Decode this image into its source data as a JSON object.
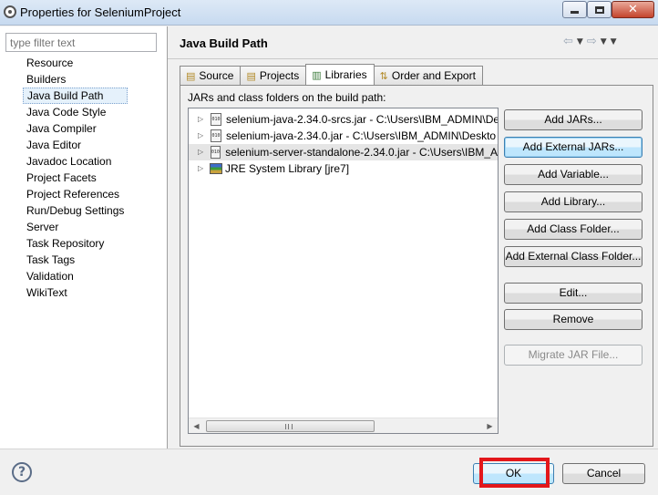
{
  "window": {
    "title": "Properties for SeleniumProject",
    "controls": {
      "minimize": "minimize-icon",
      "maximize": "maximize-icon",
      "close": "close-icon"
    }
  },
  "filter": {
    "placeholder": "type filter text",
    "value": ""
  },
  "nav": {
    "items": [
      "Resource",
      "Builders",
      "Java Build Path",
      "Java Code Style",
      "Java Compiler",
      "Java Editor",
      "Javadoc Location",
      "Project Facets",
      "Project References",
      "Run/Debug Settings",
      "Server",
      "Task Repository",
      "Task Tags",
      "Validation",
      "WikiText"
    ],
    "selected": "Java Build Path"
  },
  "page": {
    "title": "Java Build Path",
    "nav_icons": [
      "back-arrow-icon",
      "dropdown-icon",
      "forward-arrow-icon",
      "dropdown-icon",
      "view-menu-icon"
    ]
  },
  "tabs": [
    {
      "label": "Source",
      "icon": "source-folder-icon"
    },
    {
      "label": "Projects",
      "icon": "projects-icon"
    },
    {
      "label": "Libraries",
      "icon": "libraries-icon",
      "active": true
    },
    {
      "label": "Order and Export",
      "icon": "order-export-icon"
    }
  ],
  "libraries": {
    "label": "JARs and class folders on the build path:",
    "entries": [
      {
        "text": "selenium-java-2.34.0-srcs.jar - C:\\Users\\IBM_ADMIN\\De",
        "icon": "jar-icon"
      },
      {
        "text": "selenium-java-2.34.0.jar - C:\\Users\\IBM_ADMIN\\Deskto",
        "icon": "jar-icon"
      },
      {
        "text": "selenium-server-standalone-2.34.0.jar - C:\\Users\\IBM_A",
        "icon": "jar-icon",
        "selected": true
      },
      {
        "text": "JRE System Library [jre7]",
        "icon": "library-icon"
      }
    ],
    "buttons": {
      "add_jars": "Add JARs...",
      "add_external_jars": "Add External JARs...",
      "add_variable": "Add Variable...",
      "add_library": "Add Library...",
      "add_class_folder": "Add Class Folder...",
      "add_external_class_folder": "Add External Class Folder...",
      "edit": "Edit...",
      "remove": "Remove",
      "migrate_jar": "Migrate JAR File..."
    }
  },
  "footer": {
    "help_icon": "help-icon",
    "ok": "OK",
    "cancel": "Cancel"
  },
  "colors": {
    "highlight_box": "#e3171b",
    "focus_button": "#bee6fd"
  }
}
